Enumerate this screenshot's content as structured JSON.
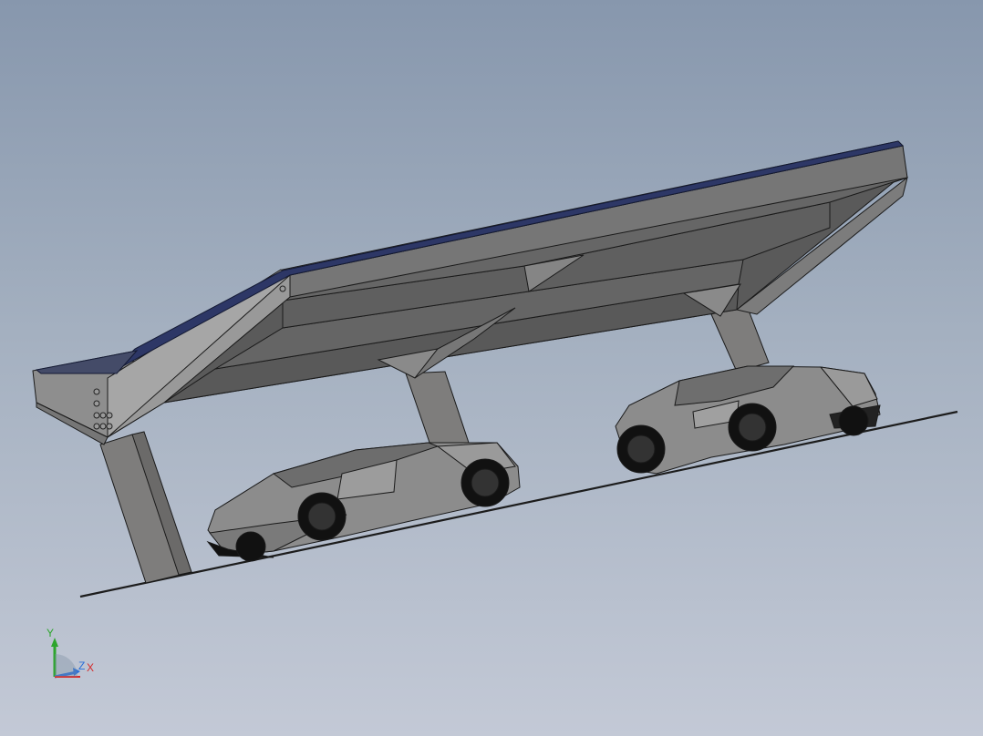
{
  "viewport": {
    "background_top": "#8797ad",
    "background_bottom": "#c3c9d6"
  },
  "model": {
    "parts": [
      "solar-carport-canopy",
      "solar-panel-array",
      "support-column",
      "ground-line",
      "sports-car",
      "sports-car"
    ],
    "colors": {
      "steel": "#6a6a6a",
      "steel_light": "#8d8d8d",
      "steel_dark": "#4e4e4e",
      "panel": "#2d3766",
      "edge": "#1a1a1a",
      "car_body": "#8a8a8a",
      "tyre": "#111111"
    }
  },
  "triad": {
    "y_label": "Y",
    "z_label": "Z",
    "x_label": "X",
    "y_color": "#2da52d",
    "z_color": "#2a6fd8",
    "x_color": "#d42a2a"
  }
}
